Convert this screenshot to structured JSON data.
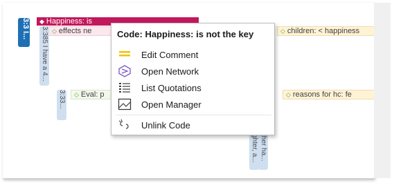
{
  "background": {
    "left_tab": "3:3 I...",
    "quotation_tab_1": "3:385 I have a 4...",
    "quotation_tab_2": "3:33...",
    "quotation_tab_3": "ghter, a...",
    "quotation_tab_4": "ther ha...",
    "code_happiness": "Happiness: is",
    "code_effects": "effects ne",
    "code_children": "children: < happiness",
    "code_eval": "Eval: p",
    "code_reasons": "reasons for hc: fe"
  },
  "context_menu": {
    "header": "Code: Happiness: is not the key",
    "items": [
      {
        "label": "Edit Comment",
        "icon": "comment-icon"
      },
      {
        "label": "Open Network",
        "icon": "network-icon"
      },
      {
        "label": "List Quotations",
        "icon": "list-icon"
      },
      {
        "label": "Open Manager",
        "icon": "manager-icon"
      },
      {
        "label": "Unlink Code",
        "icon": "unlink-icon"
      }
    ]
  },
  "colors": {
    "accent_magenta": "#c2185b",
    "tab_blue": "#1f6fb5",
    "code_green": "#5fa22c",
    "icon_purple": "#7b55c8",
    "icon_yellow": "#f2c200"
  }
}
